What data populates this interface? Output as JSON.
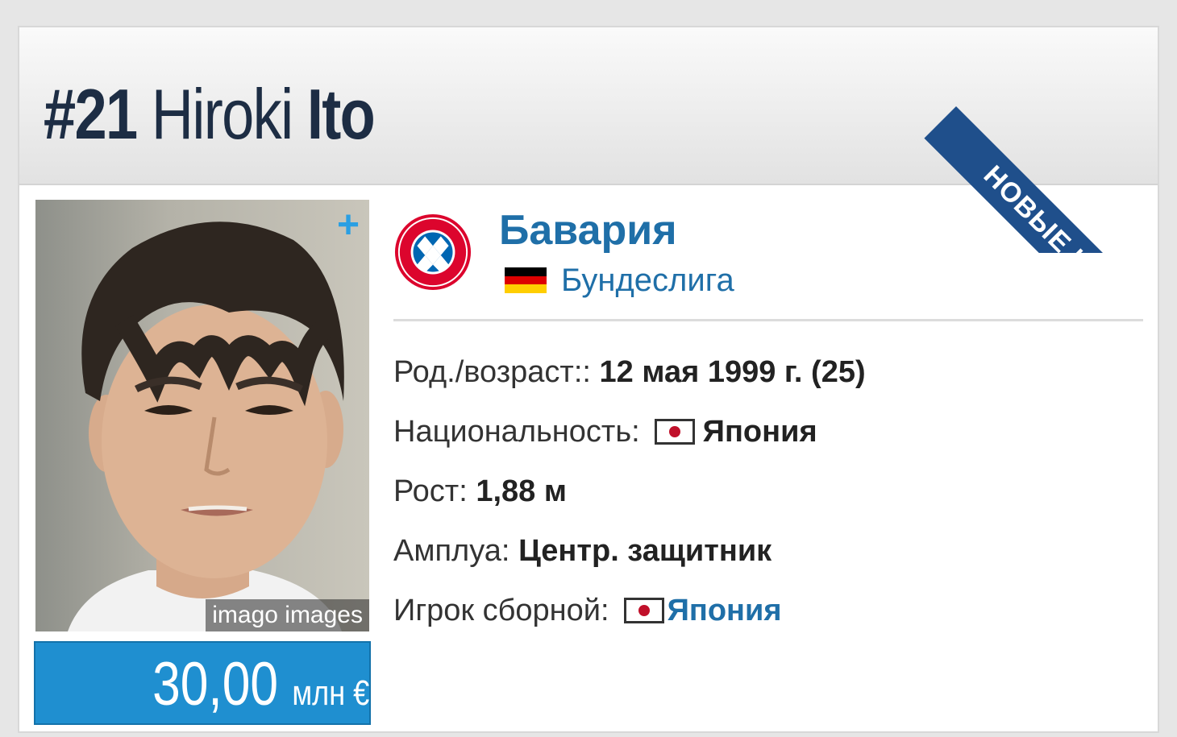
{
  "header": {
    "number": "#21",
    "first_name": "Hiroki",
    "last_name": "Ito"
  },
  "ribbon": {
    "label": "НОВЫЕ ИГРОКИ"
  },
  "photo": {
    "credit": "imago images",
    "plus_icon": "+"
  },
  "market_value": {
    "amount": "30,00",
    "unit": "млн €"
  },
  "club": {
    "name": "Бавария",
    "league": "Бундеслига",
    "logo": "bayern-logo"
  },
  "info": {
    "birth": {
      "label": "Род./возраст::",
      "value": "12 мая 1999 г. (25)"
    },
    "nationality": {
      "label": "Национальность:",
      "value": "Япония"
    },
    "height": {
      "label": "Рост:",
      "value": "1,88 м"
    },
    "position": {
      "label": "Амплуа:",
      "value": "Центр. защитник"
    },
    "national_team": {
      "label": "Игрок сборной:",
      "value": "Япония"
    }
  },
  "colors": {
    "accent": "#1f6fa8",
    "value_bg": "#1f8fd0",
    "ribbon": "#1f4f8b",
    "title": "#1d2d44"
  }
}
